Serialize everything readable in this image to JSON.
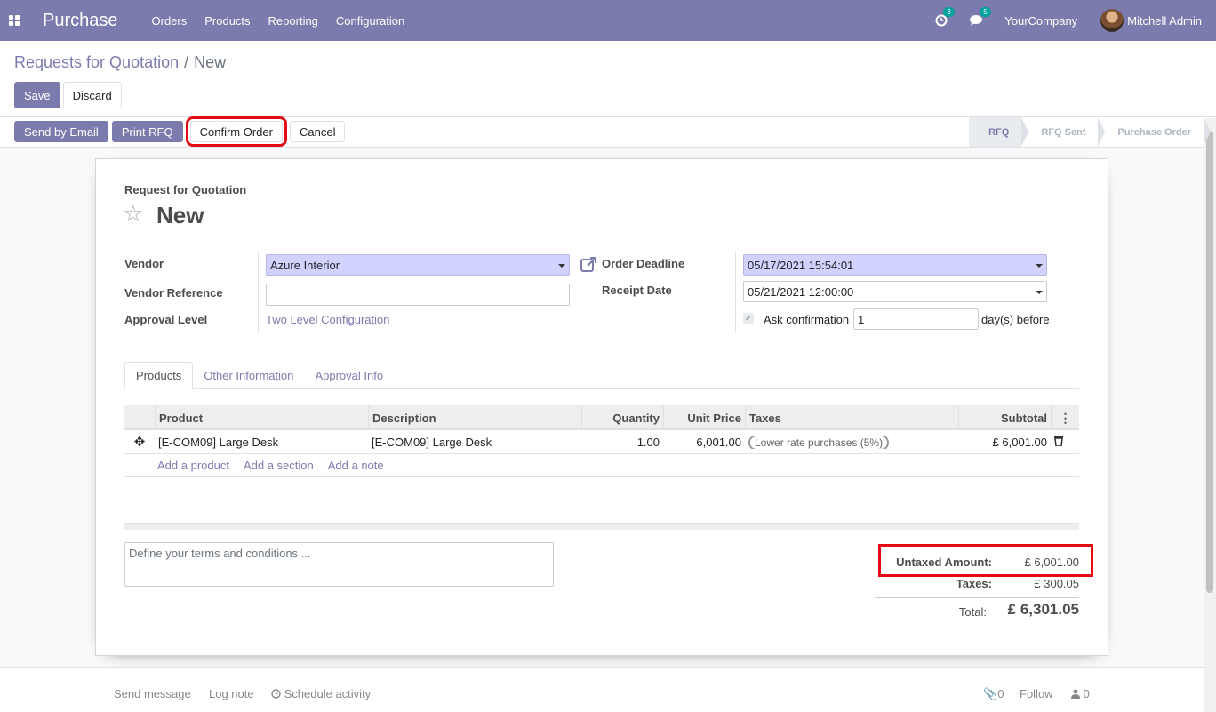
{
  "navbar": {
    "app_name": "Purchase",
    "menu": [
      "Orders",
      "Products",
      "Reporting",
      "Configuration"
    ],
    "activity_count": "3",
    "messages_count": "5",
    "company": "YourCompany",
    "user": "Mitchell Admin"
  },
  "breadcrumb": {
    "parent": "Requests for Quotation",
    "separator": "/",
    "current": "New"
  },
  "control_buttons": {
    "save": "Save",
    "discard": "Discard"
  },
  "status_buttons": {
    "send_email": "Send by Email",
    "print_rfq": "Print RFQ",
    "confirm_order": "Confirm Order",
    "cancel": "Cancel"
  },
  "stages": [
    "RFQ",
    "RFQ Sent",
    "Purchase Order"
  ],
  "active_stage": "RFQ",
  "form": {
    "subtitle": "Request for Quotation",
    "title": "New",
    "vendor_label": "Vendor",
    "vendor_value": "Azure Interior",
    "vendor_ref_label": "Vendor Reference",
    "vendor_ref_value": "",
    "approval_label": "Approval Level",
    "approval_value": "Two Level Configuration",
    "deadline_label": "Order Deadline",
    "deadline_value": "05/17/2021 15:54:01",
    "receipt_label": "Receipt Date",
    "receipt_value": "05/21/2021 12:00:00",
    "ask_confirmation_label": "Ask confirmation",
    "ask_confirmation_days": "1",
    "days_before_label": "day(s) before"
  },
  "tabs": [
    "Products",
    "Other Information",
    "Approval Info"
  ],
  "table": {
    "columns": {
      "product": "Product",
      "description": "Description",
      "quantity": "Quantity",
      "unit_price": "Unit Price",
      "taxes": "Taxes",
      "subtotal": "Subtotal"
    },
    "rows": [
      {
        "product": "[E-COM09] Large Desk",
        "description": "[E-COM09] Large Desk",
        "quantity": "1.00",
        "unit_price": "6,001.00",
        "taxes": "Lower rate purchases (5%)",
        "subtotal": "£ 6,001.00"
      }
    ],
    "add_product": "Add a product",
    "add_section": "Add a section",
    "add_note": "Add a note"
  },
  "terms_placeholder": "Define your terms and conditions ...",
  "totals": {
    "untaxed_label": "Untaxed Amount:",
    "untaxed_value": "£ 6,001.00",
    "taxes_label": "Taxes:",
    "taxes_value": "£ 300.05",
    "total_label": "Total:",
    "total_value": "£ 6,301.05"
  },
  "chatter": {
    "send_message": "Send message",
    "log_note": "Log note",
    "schedule_activity": "Schedule activity",
    "attachments_count": "0",
    "follow": "Follow",
    "followers_count": "0"
  },
  "colors": {
    "brand": "#7c7bad",
    "highlight": "#e50914",
    "required_field": "#d2d2ff"
  }
}
